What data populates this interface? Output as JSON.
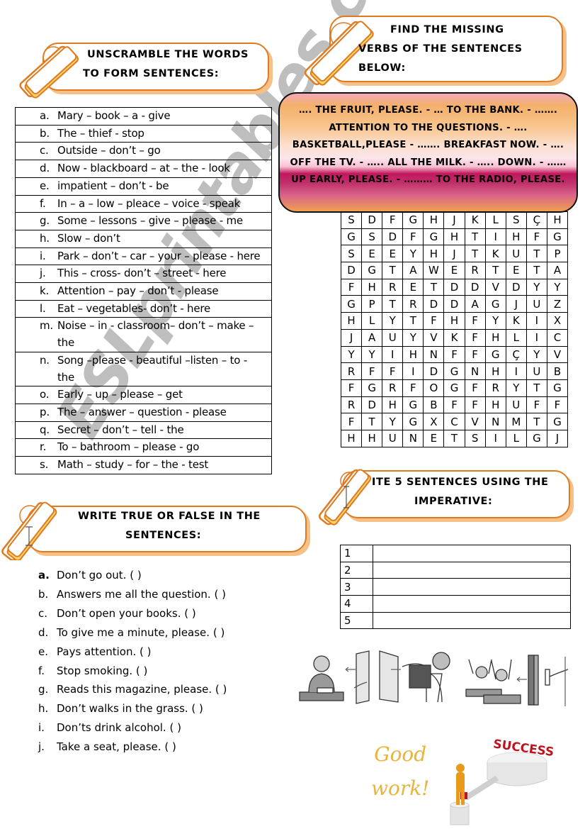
{
  "sections": {
    "unscramble": {
      "title_line1": "UNSCRAMBLE THE WORDS",
      "title_line2": "TO FORM SENTENCES:",
      "items": [
        {
          "letter": "a.",
          "text": "Mary – book – a - give"
        },
        {
          "letter": "b.",
          "text": "The – thief - stop"
        },
        {
          "letter": "c.",
          "text": "Outside – don’t – go"
        },
        {
          "letter": "d.",
          "text": "Now -  blackboard – at – the - look"
        },
        {
          "letter": "e.",
          "text": " impatient – don’t - be"
        },
        {
          "letter": "f.",
          "text": "In – a – low – pleace – voice - speak"
        },
        {
          "letter": "g.",
          "text": "Some – lessons – give – please - me"
        },
        {
          "letter": "h.",
          "text": "Slow – don’t"
        },
        {
          "letter": "i.",
          "text": "Park – don’t – car – your – please - here"
        },
        {
          "letter": "j.",
          "text": "This – cross- don’t – street - here"
        },
        {
          "letter": "k.",
          "text": "Attention – pay – don’t - please"
        },
        {
          "letter": "l.",
          "text": "Eat – vegetables- don’t - here"
        },
        {
          "letter": "m.",
          "text": "Noise – in - classroom– don’t – make – the"
        },
        {
          "letter": "n.",
          "text": "Song –please -  beautiful –listen – to - the"
        },
        {
          "letter": "o.",
          "text": "Early – up – please – get"
        },
        {
          "letter": "p.",
          "text": "The – answer – question - please"
        },
        {
          "letter": "q.",
          "text": "Secret – don’t – tell - the"
        },
        {
          "letter": "r.",
          "text": "To – bathroom – please - go"
        },
        {
          "letter": "s.",
          "text": "Math – study – for – the - test"
        }
      ]
    },
    "missing_verbs": {
      "title_line1": "FIND THE MISSING",
      "title_line2": "VERBS OF THE SENTENCES",
      "title_line3": "BELOW:",
      "box_text": "…. THE FRUIT, PLEASE. - … TO THE BANK. - ……. ATTENTION TO THE QUESTIONS. -  …. BASKETBALL,PLEASE - ……. BREAKFAST NOW. - …. OFF THE TV. - ….. ALL THE MILK. - ….. DOWN. - …… UP EARLY, PLEASE. - ……… TO THE RADIO, PLEASE.",
      "box_colors": {
        "top": "#f4b06a",
        "middle": "#fde4ea",
        "band": "#c2175e"
      },
      "word_search": [
        [
          "S",
          "D",
          "F",
          "G",
          "H",
          "J",
          "K",
          "L",
          "S",
          "Ç",
          "H"
        ],
        [
          "G",
          "S",
          "D",
          "F",
          "G",
          "H",
          "T",
          "I",
          "H",
          "F",
          "G"
        ],
        [
          "S",
          "E",
          "E",
          "Y",
          "H",
          "J",
          "T",
          "K",
          "U",
          "T",
          "P"
        ],
        [
          "D",
          "G",
          "T",
          "A",
          "W",
          "E",
          "R",
          "T",
          "E",
          "T",
          "A"
        ],
        [
          "F",
          "H",
          "R",
          "E",
          "T",
          "D",
          "D",
          "V",
          "D",
          "Y",
          "Y"
        ],
        [
          "G",
          "P",
          "T",
          "R",
          "D",
          "D",
          "A",
          "G",
          "J",
          "U",
          "Z"
        ],
        [
          "H",
          "L",
          "Y",
          "T",
          "F",
          "H",
          "F",
          "Y",
          "K",
          "I",
          "X"
        ],
        [
          "J",
          "A",
          "U",
          "Y",
          "V",
          "K",
          "F",
          "H",
          "L",
          "I",
          "C"
        ],
        [
          "Y",
          "Y",
          "I",
          "H",
          "N",
          "F",
          "F",
          "G",
          "Ç",
          "Y",
          "V"
        ],
        [
          "R",
          "F",
          "F",
          "I",
          "D",
          "G",
          "N",
          "H",
          "I",
          "U",
          "B"
        ],
        [
          "F",
          "G",
          "R",
          "F",
          "O",
          "G",
          "F",
          "R",
          "Y",
          "T",
          "G"
        ],
        [
          "R",
          "D",
          "H",
          "G",
          "B",
          "F",
          "F",
          "H",
          "U",
          "F",
          "F"
        ],
        [
          "F",
          "T",
          "Y",
          "G",
          "X",
          "C",
          "V",
          "N",
          "M",
          "T",
          "G"
        ],
        [
          "H",
          "H",
          "U",
          "N",
          "E",
          "T",
          "S",
          "I",
          "L",
          "G",
          "J"
        ]
      ]
    },
    "true_false": {
      "title_line1": "WRITE TRUE OR FALSE IN THE",
      "title_line2": "SENTENCES:",
      "items": [
        {
          "letter": "a.",
          "text": "Don’t go out. (   )"
        },
        {
          "letter": "b.",
          "text": "Answers me all the question. (   )"
        },
        {
          "letter": "c.",
          "text": "Don’t open your books. (   )"
        },
        {
          "letter": "d.",
          "text": "To give me a minute, please. (   )"
        },
        {
          "letter": "e.",
          "text": "Pays attention. (   )"
        },
        {
          "letter": "f.",
          "text": "Stop smoking. (   )"
        },
        {
          "letter": "g.",
          "text": "Reads this magazine, please. (   )"
        },
        {
          "letter": "h.",
          "text": "Don’t walks in the grass. (   )"
        },
        {
          "letter": "i.",
          "text": "Don’ts drink alcohol. (   )"
        },
        {
          "letter": "j.",
          "text": "Take a seat, please. (   )"
        }
      ]
    },
    "imperative": {
      "title_line1": "ITE 5 SENTENCES USING THE",
      "title_line2": "IMPERATIVE:",
      "rows": [
        "1",
        "2",
        "3",
        "4",
        "5"
      ]
    }
  },
  "footer": {
    "good_work_line1": "Good",
    "good_work_line2": "work!",
    "success_label": "SUCCESS",
    "illustrations": [
      "teacher-at-desk",
      "opening-window",
      "sitting-on-chair",
      "students-raising-hands",
      "closing-door"
    ]
  },
  "watermark": "ESLprintables.com",
  "colors": {
    "accent_orange": "#e07a1f",
    "shadow_orange": "#f6c089",
    "good_work": "#e8b43c",
    "success_red": "#c0141c"
  }
}
